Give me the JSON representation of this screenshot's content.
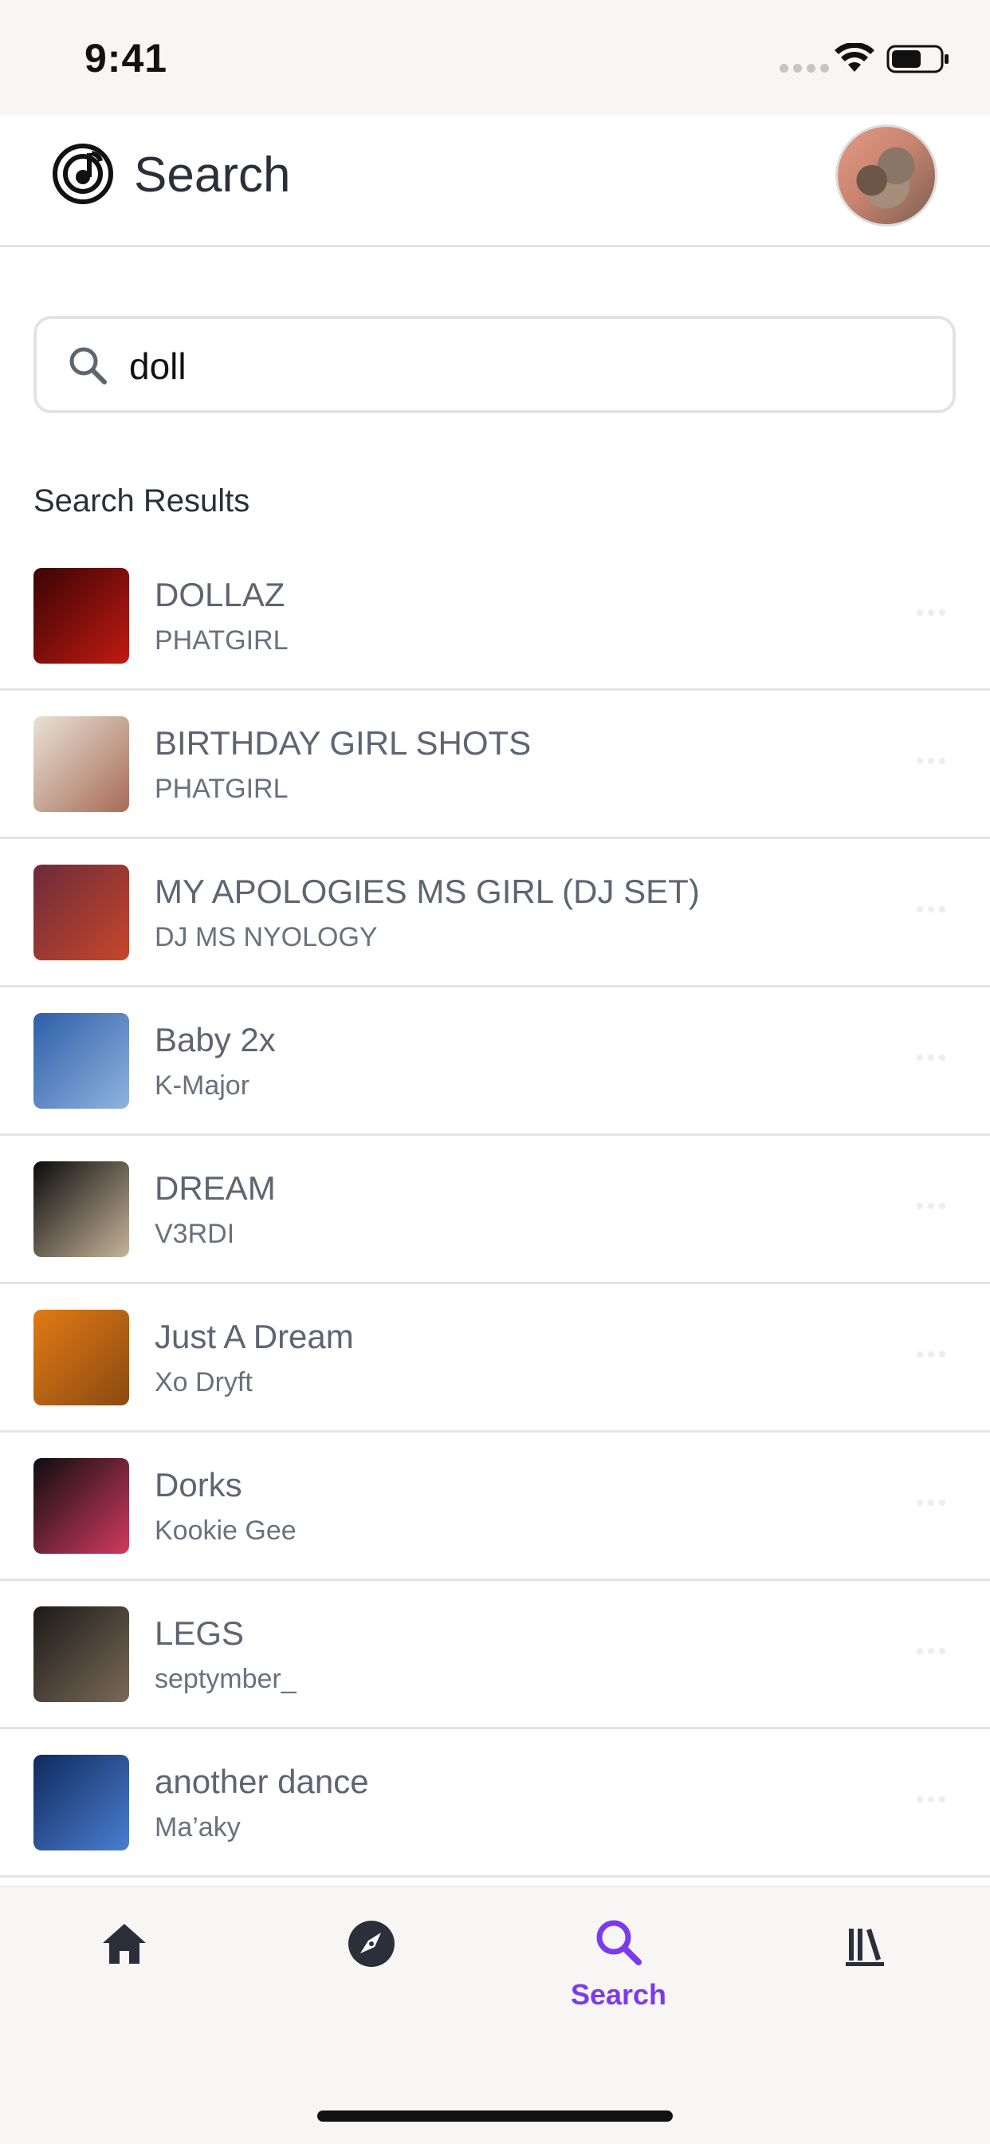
{
  "status_bar": {
    "time": "9:41"
  },
  "header": {
    "title": "Search"
  },
  "search": {
    "query": "doll"
  },
  "results_section": {
    "title": "Search Results"
  },
  "results": [
    {
      "title": "DOLLAZ",
      "artist": "PHATGIRL",
      "art_colors": [
        "#3a0404",
        "#c11a12"
      ]
    },
    {
      "title": "BIRTHDAY GIRL SHOTS",
      "artist": "PHATGIRL",
      "art_colors": [
        "#e8e2d6",
        "#a86b56"
      ]
    },
    {
      "title": "MY APOLOGIES MS GIRL (DJ SET)",
      "artist": "DJ MS NYOLOGY",
      "art_colors": [
        "#6b2b3a",
        "#c8462a"
      ]
    },
    {
      "title": "Baby 2x",
      "artist": "K-Major",
      "art_colors": [
        "#2d5ea8",
        "#90b4de"
      ]
    },
    {
      "title": "DREAM",
      "artist": "V3RDI",
      "art_colors": [
        "#0b0b0b",
        "#c7b49a"
      ]
    },
    {
      "title": "Just A Dream",
      "artist": "Xo Dryft",
      "art_colors": [
        "#e07a15",
        "#8a4a12"
      ]
    },
    {
      "title": "Dorks",
      "artist": "Kookie Gee",
      "art_colors": [
        "#0d0d10",
        "#d23a5e"
      ]
    },
    {
      "title": "LEGS",
      "artist": "septymber_",
      "art_colors": [
        "#1c1a18",
        "#7a6a58"
      ]
    },
    {
      "title": "another dance",
      "artist": "Ma’aky",
      "art_colors": [
        "#0f2a5e",
        "#4b7fd0"
      ]
    }
  ],
  "tabs": [
    {
      "name": "home",
      "icon": "home-icon",
      "label": ""
    },
    {
      "name": "explore",
      "icon": "compass-icon",
      "label": ""
    },
    {
      "name": "search",
      "icon": "search-icon",
      "label": "Search",
      "active": true
    },
    {
      "name": "library",
      "icon": "library-icon",
      "label": ""
    }
  ],
  "colors": {
    "accent": "#7c3aed",
    "text": "#2b2f3a",
    "muted": "#6b707d",
    "icon_dark": "#2b2f3a"
  }
}
